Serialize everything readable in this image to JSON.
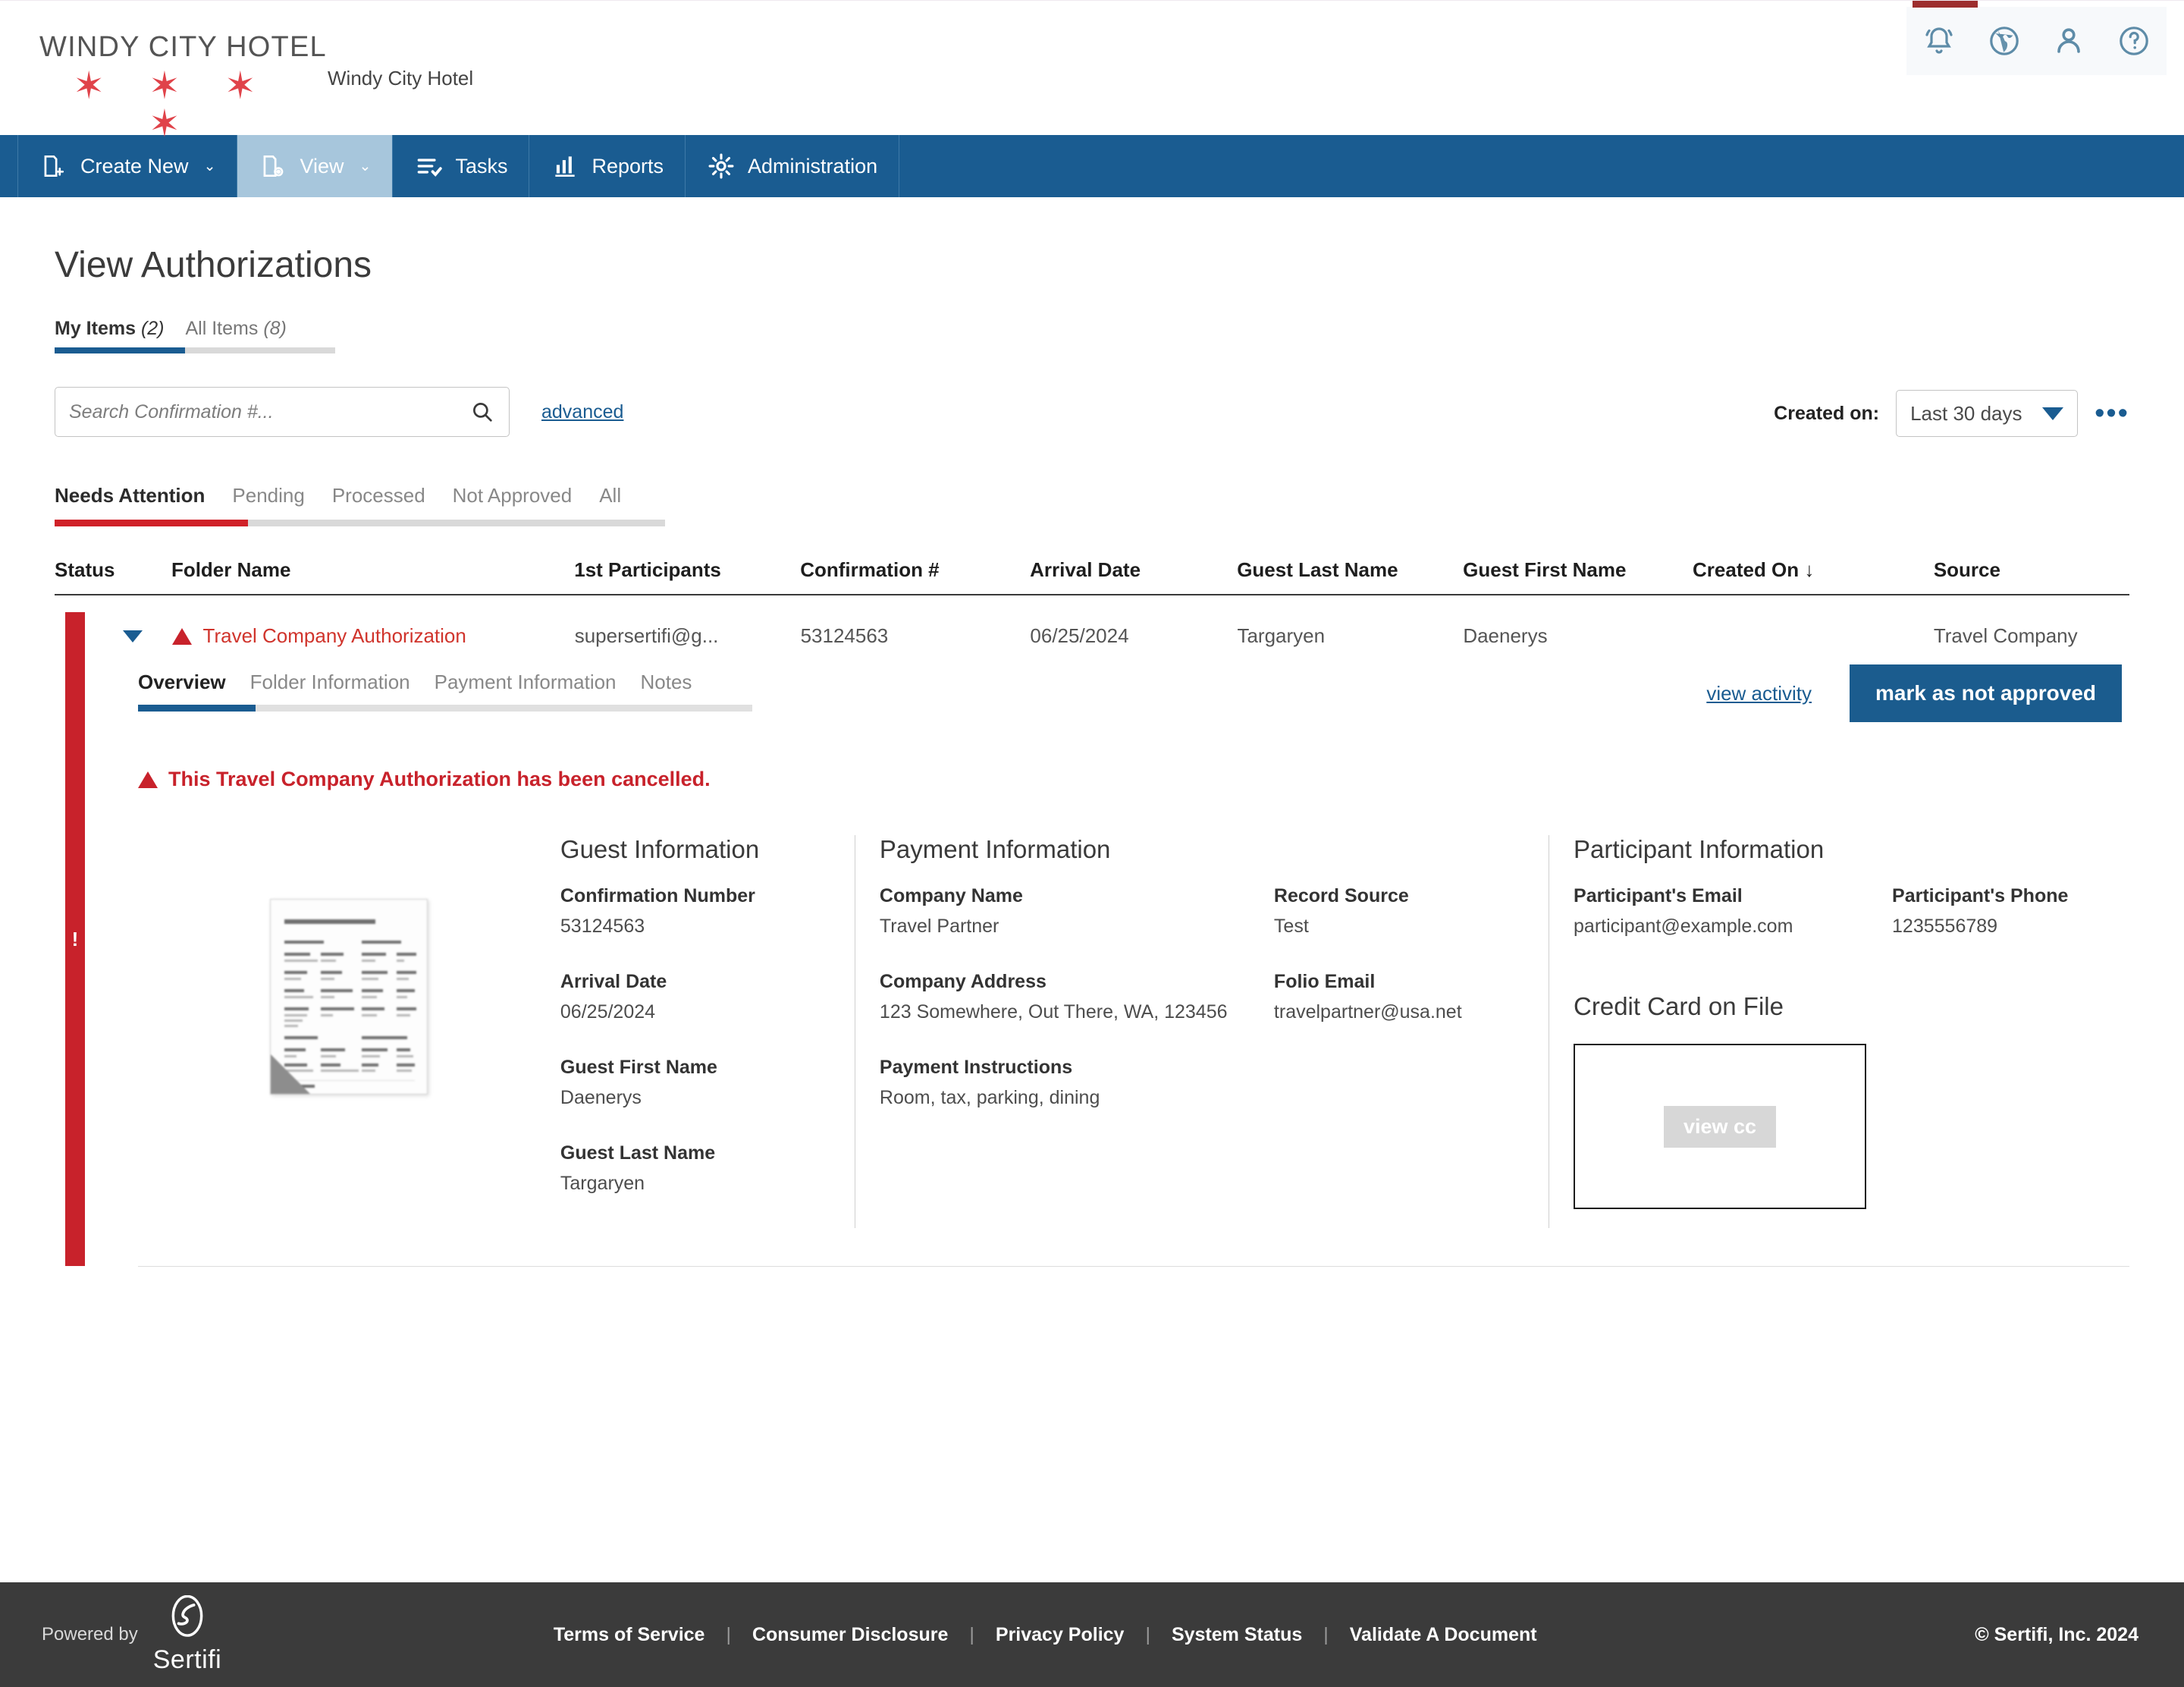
{
  "header": {
    "logo_text": "WINDY CITY HOTEL",
    "logo_stars": "✶ ✶ ✶ ✶",
    "hotel_name": "Windy City Hotel",
    "icons": [
      {
        "name": "notification-bell-icon",
        "label": "Notifications"
      },
      {
        "name": "globe-icon",
        "label": "Language"
      },
      {
        "name": "user-account-icon",
        "label": "Account"
      },
      {
        "name": "help-icon",
        "label": "Help"
      }
    ],
    "accent_red": "#9d2d2d"
  },
  "nav": {
    "items": [
      {
        "label": "Create New",
        "icon": "folder-add-icon",
        "chevron": "⌄",
        "active": false
      },
      {
        "label": "View",
        "icon": "folder-view-icon",
        "chevron": "⌄",
        "active": true
      },
      {
        "label": "Tasks",
        "icon": "tasks-check-icon",
        "chevron": "",
        "active": false
      },
      {
        "label": "Reports",
        "icon": "bar-chart-icon",
        "chevron": "",
        "active": false
      },
      {
        "label": "Administration",
        "icon": "gear-icon",
        "chevron": "",
        "active": false
      }
    ],
    "background": "#1a5c91"
  },
  "page": {
    "title": "View Authorizations",
    "item_tabs": [
      {
        "label": "My Items",
        "count": "(2)",
        "active": true
      },
      {
        "label": "All Items",
        "count": "(8)",
        "active": false
      }
    ],
    "search": {
      "placeholder": "Search Confirmation #...",
      "value": "",
      "icon": "search-icon",
      "advanced_label": "advanced"
    },
    "created_on": {
      "label": "Created on:",
      "selected": "Last 30 days",
      "overflow": "•••"
    },
    "filter_tabs": [
      {
        "label": "Needs Attention",
        "active": true
      },
      {
        "label": "Pending",
        "active": false
      },
      {
        "label": "Processed",
        "active": false
      },
      {
        "label": "Not Approved",
        "active": false
      },
      {
        "label": "All",
        "active": false
      }
    ],
    "filter_accent": "#d02128"
  },
  "table": {
    "columns": [
      "Status",
      "Folder Name",
      "1st Participants",
      "Confirmation #",
      "Arrival Date",
      "Guest Last Name",
      "Guest First Name",
      "Created On ↓",
      "Source"
    ],
    "rows": [
      {
        "status": "needs-attention",
        "status_marker": "!",
        "expanded": true,
        "folder_name": "Travel Company Authorization",
        "participants": "supersertifi@g...",
        "confirmation": "53124563",
        "arrival_date": "06/25/2024",
        "guest_last_name": "Targaryen",
        "guest_first_name": "Daenerys",
        "created_on": "",
        "source": "Travel Company"
      }
    ]
  },
  "detail": {
    "tabs": [
      {
        "label": "Overview",
        "active": true
      },
      {
        "label": "Folder Information",
        "active": false
      },
      {
        "label": "Payment Information",
        "active": false
      },
      {
        "label": "Notes",
        "active": false
      }
    ],
    "view_activity_label": "view activity",
    "primary_button_label": "mark as not approved",
    "alert_message": "This Travel Company Authorization has been cancelled.",
    "alert_color": "#c8222b",
    "guest_information": {
      "title": "Guest Information",
      "fields": [
        {
          "label": "Confirmation Number",
          "value": "53124563"
        },
        {
          "label": "Arrival Date",
          "value": "06/25/2024"
        },
        {
          "label": "Guest First Name",
          "value": "Daenerys"
        },
        {
          "label": "Guest Last Name",
          "value": "Targaryen"
        }
      ]
    },
    "payment_information": {
      "title": "Payment Information",
      "left_fields": [
        {
          "label": "Company Name",
          "value": "Travel Partner"
        },
        {
          "label": "Company Address",
          "value": "123 Somewhere, Out There, WA, 123456"
        },
        {
          "label": "Payment Instructions",
          "value": "Room, tax, parking, dining"
        }
      ],
      "right_fields": [
        {
          "label": "Record Source",
          "value": "Test"
        },
        {
          "label": "Folio Email",
          "value": "travelpartner@usa.net"
        }
      ]
    },
    "participant_information": {
      "title": "Participant Information",
      "email_label": "Participant's Email",
      "email_value": "participant@example.com",
      "phone_label": "Participant's Phone",
      "phone_value": "1235556789",
      "credit_card_title": "Credit Card on File",
      "view_cc_label": "view cc"
    }
  },
  "footer": {
    "powered_by": "Powered by",
    "brand": "Sertifi",
    "links": [
      "Terms of Service",
      "Consumer Disclosure",
      "Privacy Policy",
      "System Status",
      "Validate A Document"
    ],
    "separator": "|",
    "copyright": "© Sertifi, Inc. 2024",
    "background": "#3b3b3b"
  }
}
